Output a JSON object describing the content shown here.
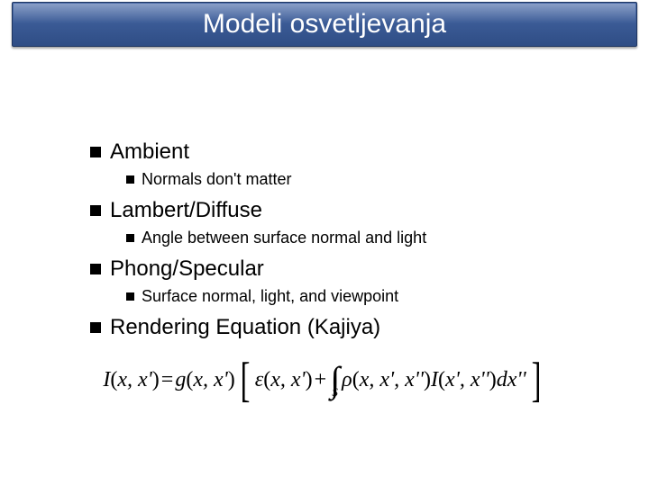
{
  "title": "Modeli osvetljevanja",
  "items": [
    {
      "label": "Ambient",
      "sub": "Normals don't matter"
    },
    {
      "label": "Lambert/Diffuse",
      "sub": "Angle between surface normal and light"
    },
    {
      "label": "Phong/Specular",
      "sub": "Surface normal, light, and viewpoint"
    },
    {
      "label": "Rendering Equation (Kajiya)",
      "sub": null
    }
  ],
  "equation": {
    "lhs": "I",
    "lhs_args": "x, x'",
    "g": "g",
    "g_args": "x, x'",
    "eps": "ε",
    "eps_args": "x, x'",
    "rho": "ρ",
    "rho_args": "x, x', x''",
    "I2": "I",
    "I2_args": "x', x''",
    "dx": "dx''",
    "int_sub": "S"
  }
}
